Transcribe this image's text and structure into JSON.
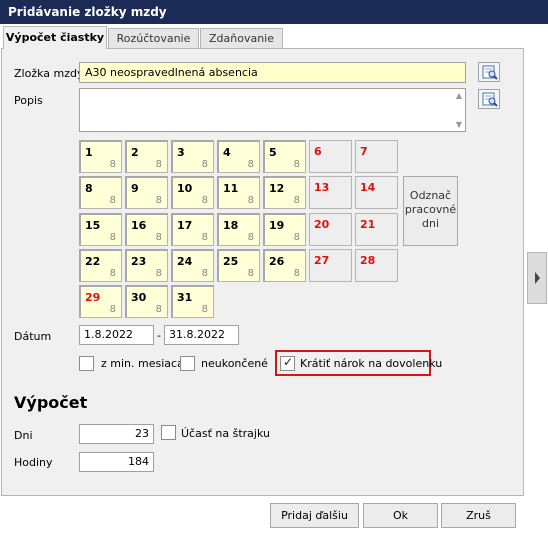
{
  "window": {
    "title": "Pridávanie zložky mzdy"
  },
  "tabs": [
    "Výpočet čiastky",
    "Rozúčtovanie",
    "Zdaňovanie"
  ],
  "form": {
    "zlozka_label": "Zložka mzdy",
    "zlozka_value": "A30  neospravedlnená absencia",
    "popis_label": "Popis",
    "popis_value": "",
    "datum_label": "Dátum",
    "date_from": "1.8.2022",
    "date_sep": "-",
    "date_to": "31.8.2022"
  },
  "calendar": {
    "days": [
      {
        "day": "1",
        "hours": "8",
        "weekend": false
      },
      {
        "day": "2",
        "hours": "8",
        "weekend": false
      },
      {
        "day": "3",
        "hours": "8",
        "weekend": false
      },
      {
        "day": "4",
        "hours": "8",
        "weekend": false
      },
      {
        "day": "5",
        "hours": "8",
        "weekend": false
      },
      {
        "day": "6",
        "hours": "",
        "weekend": true
      },
      {
        "day": "7",
        "hours": "",
        "weekend": true
      },
      {
        "day": "8",
        "hours": "8",
        "weekend": false
      },
      {
        "day": "9",
        "hours": "8",
        "weekend": false
      },
      {
        "day": "10",
        "hours": "8",
        "weekend": false
      },
      {
        "day": "11",
        "hours": "8",
        "weekend": false
      },
      {
        "day": "12",
        "hours": "8",
        "weekend": false
      },
      {
        "day": "13",
        "hours": "",
        "weekend": true
      },
      {
        "day": "14",
        "hours": "",
        "weekend": true
      },
      {
        "day": "15",
        "hours": "8",
        "weekend": false
      },
      {
        "day": "16",
        "hours": "8",
        "weekend": false
      },
      {
        "day": "17",
        "hours": "8",
        "weekend": false
      },
      {
        "day": "18",
        "hours": "8",
        "weekend": false
      },
      {
        "day": "19",
        "hours": "8",
        "weekend": false
      },
      {
        "day": "20",
        "hours": "",
        "weekend": true
      },
      {
        "day": "21",
        "hours": "",
        "weekend": true
      },
      {
        "day": "22",
        "hours": "8",
        "weekend": false
      },
      {
        "day": "23",
        "hours": "8",
        "weekend": false
      },
      {
        "day": "24",
        "hours": "8",
        "weekend": false
      },
      {
        "day": "25",
        "hours": "8",
        "weekend": false
      },
      {
        "day": "26",
        "hours": "8",
        "weekend": false
      },
      {
        "day": "27",
        "hours": "",
        "weekend": true
      },
      {
        "day": "28",
        "hours": "",
        "weekend": true
      },
      {
        "day": "29",
        "hours": "8",
        "weekend": false,
        "holiday": true
      },
      {
        "day": "30",
        "hours": "8",
        "weekend": false
      },
      {
        "day": "31",
        "hours": "8",
        "weekend": false
      }
    ],
    "mark_workdays_label_1": "Odznač",
    "mark_workdays_label_2": "pracovné",
    "mark_workdays_label_3": "dni"
  },
  "options": {
    "min_mesiaca_label": "z min. mesiaca",
    "min_mesiaca_checked": false,
    "neukoncene_label": "neukončené",
    "neukoncene_checked": false,
    "kratit_label": "Krátiť nárok na dovolenku",
    "kratit_checked": true,
    "check_mark": "✓"
  },
  "vypocet": {
    "heading": "Výpočet",
    "dni_label": "Dni",
    "dni_value": "23",
    "strajk_label": "Účasť na štrajku",
    "strajk_checked": false,
    "hodiny_label": "Hodiny",
    "hodiny_value": "184"
  },
  "footer": {
    "next_label": "Pridaj ďalšiu",
    "ok_label": "Ok",
    "cancel_label": "Zruš"
  },
  "colors": {
    "titlebar": "#1b2b55",
    "weekend_text": "#e01010",
    "highlight": "#d01818",
    "workday_bg": "#ffffd8"
  },
  "icons": [
    "lookup-icon",
    "chevron-right-icon"
  ]
}
